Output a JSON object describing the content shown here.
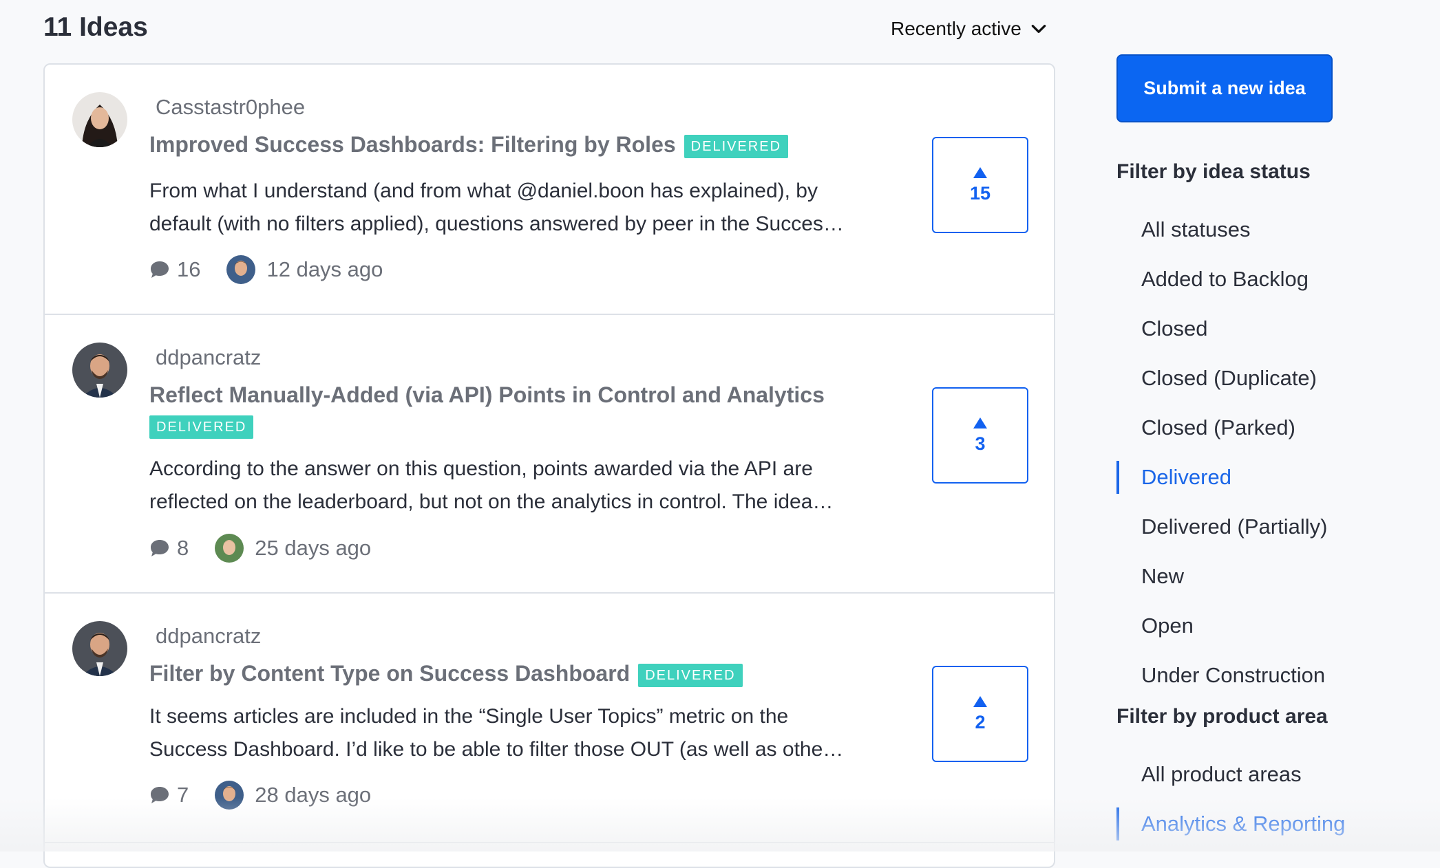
{
  "header": {
    "count_title": "11 Ideas",
    "sort_label": "Recently active"
  },
  "ideas": [
    {
      "author": "Casstastr0phee",
      "title": "Improved Success Dashboards: Filtering by Roles",
      "status": "DELIVERED",
      "excerpt_line1": "From what I understand (and from what @daniel.boon has explained), by",
      "excerpt_line2": "default (with no filters applied), questions answered by peer in the Succes…",
      "comments": "16",
      "time": "12 days ago",
      "votes": "15"
    },
    {
      "author": "ddpancratz",
      "title": "Reflect Manually-Added (via API) Points in Control and Analytics",
      "status": "DELIVERED",
      "excerpt_line1": "According to the answer on this question, points awarded via the API are",
      "excerpt_line2": "reflected on the leaderboard, but not on the analytics in control.  The idea…",
      "comments": "8",
      "time": "25 days ago",
      "votes": "3"
    },
    {
      "author": "ddpancratz",
      "title": "Filter by Content Type on Success Dashboard",
      "status": "DELIVERED",
      "excerpt_line1": "It seems articles are included in the “Single User Topics” metric on the",
      "excerpt_line2": "Success Dashboard. I’d like to be able to filter those OUT (as well as othe…",
      "comments": "7",
      "time": "28 days ago",
      "votes": "2"
    }
  ],
  "sidebar": {
    "submit_label": "Submit a new idea",
    "status_heading": "Filter by idea status",
    "statuses": [
      "All statuses",
      "Added to Backlog",
      "Closed",
      "Closed (Duplicate)",
      "Closed (Parked)",
      "Delivered",
      "Delivered (Partially)",
      "New",
      "Open",
      "Under Construction"
    ],
    "active_status": "Delivered",
    "area_heading": "Filter by product area",
    "areas": [
      "All product areas",
      "Analytics & Reporting"
    ],
    "active_area": "Analytics & Reporting"
  },
  "colors": {
    "accent": "#1261f0",
    "badge": "#3fd1bd",
    "submit_bg": "#0b66f2"
  },
  "icons": {
    "sort": "chevron-down-icon",
    "comments": "speech-bubble-icon",
    "upvote": "triangle-up-icon"
  }
}
